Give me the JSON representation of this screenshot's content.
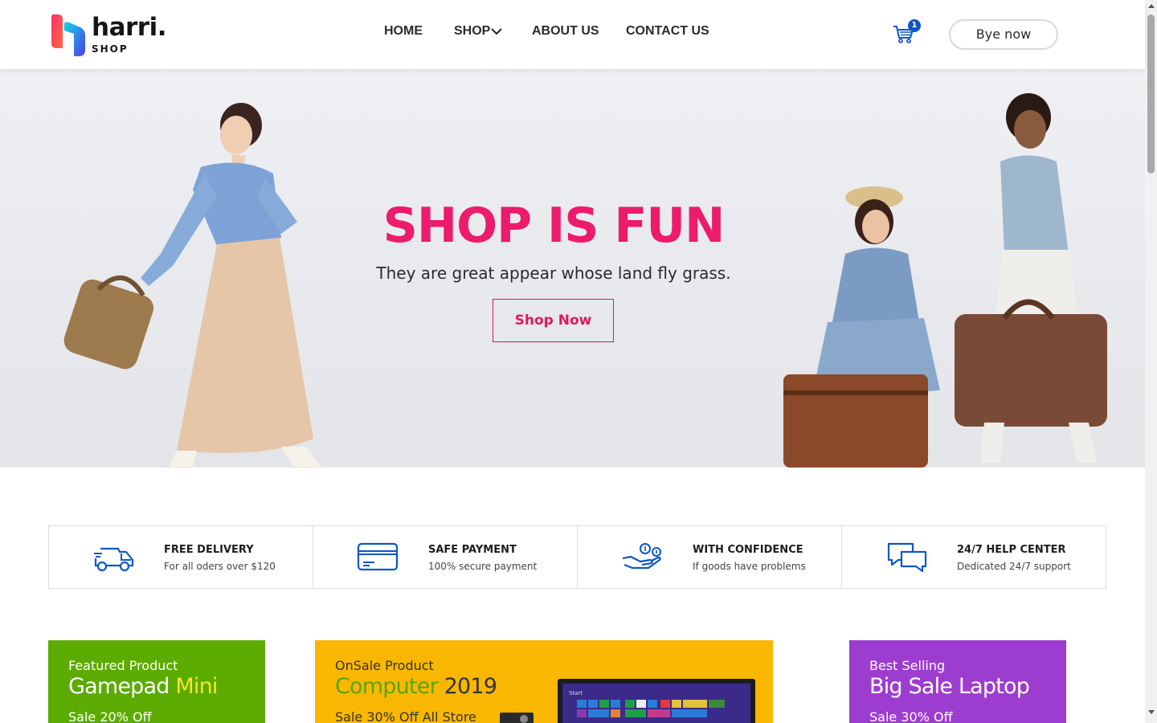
{
  "brand": {
    "name": "harri.",
    "tagline": "SHOP"
  },
  "nav": {
    "home": "HOME",
    "shop": "SHOP",
    "about": "ABOUT US",
    "contact": "CONTACT US"
  },
  "cart": {
    "count": "1"
  },
  "header_button": "Bye now",
  "hero": {
    "title": "SHOP IS FUN",
    "subtitle": "They are great appear whose land fly grass.",
    "cta": "Shop Now"
  },
  "features": [
    {
      "icon": "delivery-truck-icon",
      "title": "FREE DELIVERY",
      "subtitle": "For all oders over $120"
    },
    {
      "icon": "credit-card-icon",
      "title": "SAFE PAYMENT",
      "subtitle": "100% secure payment"
    },
    {
      "icon": "hand-coins-icon",
      "title": "WITH CONFIDENCE",
      "subtitle": "If goods have problems"
    },
    {
      "icon": "chat-bubbles-icon",
      "title": "24/7 HELP CENTER",
      "subtitle": "Dedicated 24/7 support"
    }
  ],
  "promos": [
    {
      "kicker": "Featured Product",
      "title_a": "Gamepad",
      "title_b": "Mini",
      "sale": "Sale 20% Off",
      "color": "#5cab00"
    },
    {
      "kicker": "OnSale Product",
      "title_a": "Computer",
      "title_b": "2019",
      "sale": "Sale 30% Off All Store",
      "color": "#f9b701"
    },
    {
      "kicker": "Best Selling",
      "title_a": "Big Sale Laptop",
      "sale": "Sale 30% Off",
      "color": "#9d3dd0"
    }
  ],
  "colors": {
    "accent_pink": "#ec1b6b",
    "brand_blue": "#0c57c8"
  }
}
